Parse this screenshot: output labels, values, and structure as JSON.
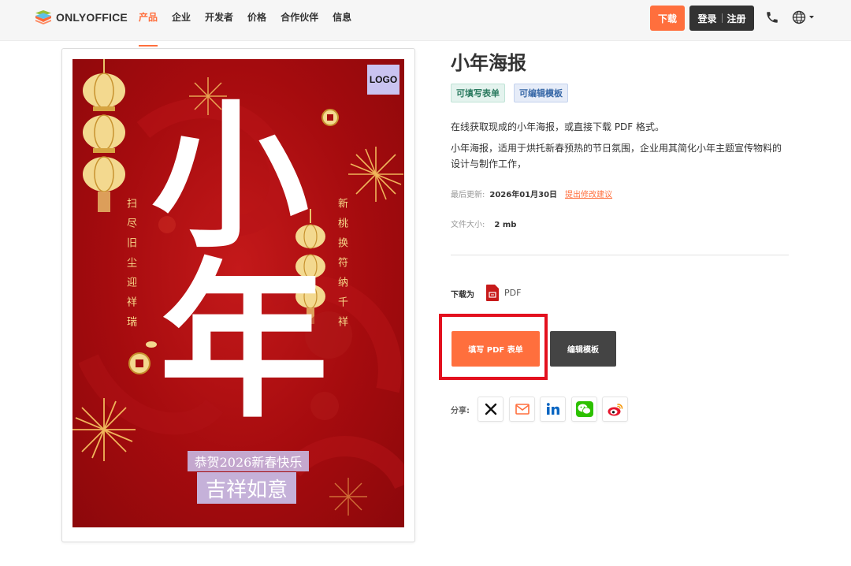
{
  "header": {
    "logo_text": "ONLYOFFICE",
    "nav": [
      "产品",
      "企业",
      "开发者",
      "价格",
      "合作伙伴",
      "信息"
    ],
    "download_label": "下载",
    "login_label": "登录",
    "register_label": "注册"
  },
  "poster": {
    "logo_label": "LOGO",
    "left_couplet": "扫尽旧尘迎祥瑞",
    "right_couplet": "新桃换符纳千祥",
    "big_char_1": "小",
    "big_char_2": "年",
    "greeting_line1": "恭贺2026新春快乐",
    "greeting_line2": "吉祥如意",
    "colors": {
      "background": "#a50b0e",
      "gold": "#f7d98a",
      "lantern": "#f3d98f"
    }
  },
  "info": {
    "title": "小年海报",
    "tags": [
      "可填写表单",
      "可编辑模板"
    ],
    "description_short": "在线获取现成的小年海报，或直接下载 PDF 格式。",
    "description_long": "小年海报，适用于烘托新春预热的节日氛围，企业用其简化小年主题宣传物料的设计与制作工作，",
    "last_updated_label": "最后更新:",
    "last_updated_value": "2026年01月30日",
    "suggest_link": "提出修改建议",
    "file_size_label": "文件大小:",
    "file_size_value": "2 mb",
    "download_as_label": "下载为",
    "download_format": "PDF",
    "fill_button": "填写 PDF 表单",
    "edit_button": "编辑模板",
    "share_label": "分享:",
    "share_icons": [
      "x-icon",
      "email-icon",
      "linkedin-icon",
      "wechat-icon",
      "weibo-icon"
    ]
  },
  "colors": {
    "accent": "#ff6f3d",
    "dark": "#333333",
    "highlight": "#e3101e"
  }
}
